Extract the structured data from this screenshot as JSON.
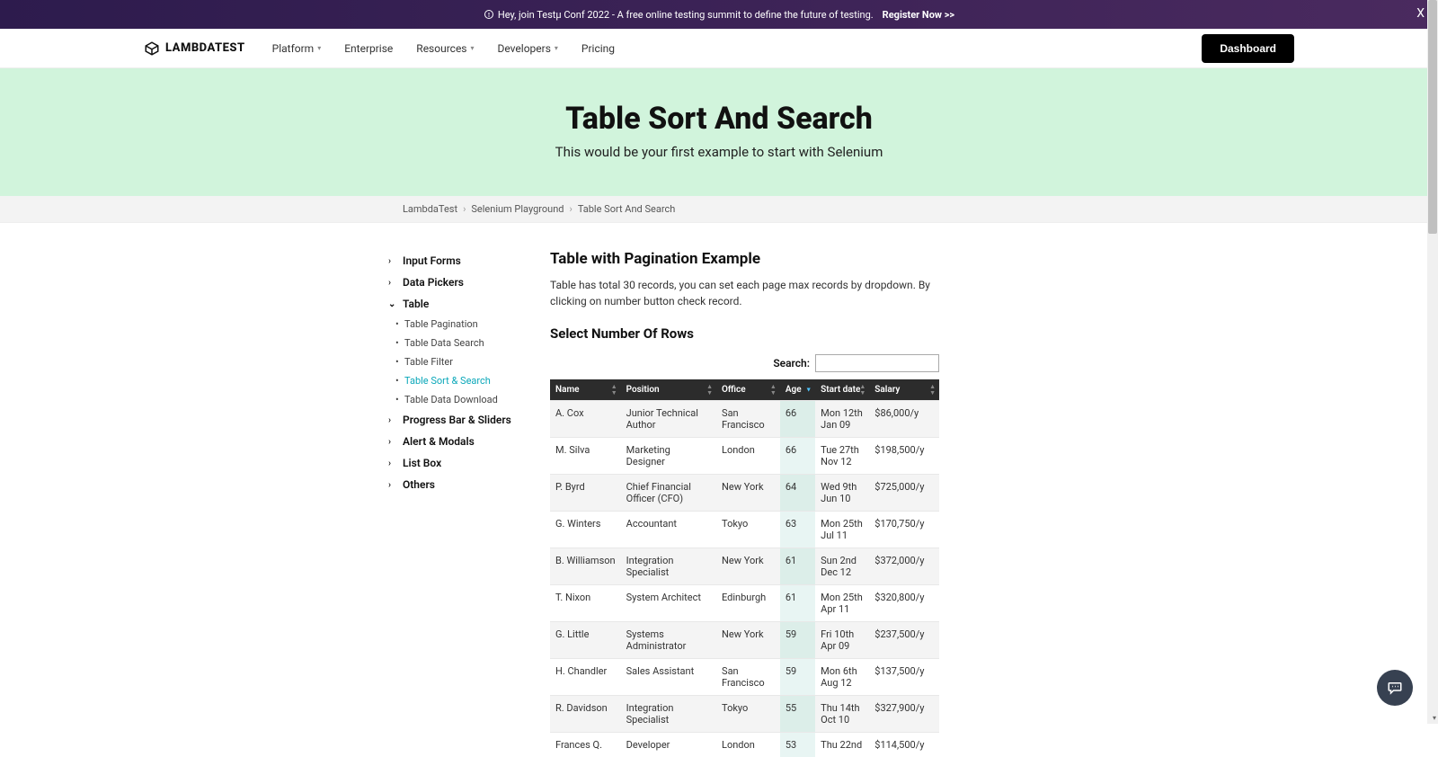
{
  "banner": {
    "text": "Hey, join Testμ Conf 2022 - A free online testing summit to define the future of testing.",
    "cta": "Register Now >>",
    "close": "X"
  },
  "nav": {
    "brand": "LAMBDATEST",
    "items": [
      "Platform",
      "Enterprise",
      "Resources",
      "Developers",
      "Pricing"
    ],
    "has_caret": [
      true,
      false,
      true,
      true,
      false
    ],
    "dashboard": "Dashboard"
  },
  "hero": {
    "title": "Table Sort And Search",
    "subtitle": "This would be your first example to start with Selenium"
  },
  "breadcrumbs": [
    "LambdaTest",
    "Selenium Playground",
    "Table Sort And Search"
  ],
  "sidebar": {
    "groups": [
      {
        "label": "Input Forms",
        "expanded": false
      },
      {
        "label": "Data Pickers",
        "expanded": false
      },
      {
        "label": "Table",
        "expanded": true,
        "children": [
          {
            "label": "Table Pagination",
            "active": false
          },
          {
            "label": "Table Data Search",
            "active": false
          },
          {
            "label": "Table Filter",
            "active": false
          },
          {
            "label": "Table Sort & Search",
            "active": true
          },
          {
            "label": "Table Data Download",
            "active": false
          }
        ]
      },
      {
        "label": "Progress Bar & Sliders",
        "expanded": false
      },
      {
        "label": "Alert & Modals",
        "expanded": false
      },
      {
        "label": "List Box",
        "expanded": false
      },
      {
        "label": "Others",
        "expanded": false
      }
    ]
  },
  "content": {
    "heading": "Table with Pagination Example",
    "desc": "Table has total 30 records, you can set each page max records by dropdown. By clicking on number button check record.",
    "rows_heading": "Select Number Of Rows",
    "search_label": "Search:",
    "columns": [
      "Name",
      "Position",
      "Office",
      "Age",
      "Start date",
      "Salary"
    ],
    "sorted_col": 3,
    "rows": [
      {
        "name": "A. Cox",
        "position": "Junior Technical Author",
        "office": "San Francisco",
        "age": "66",
        "start": "Mon 12th Jan 09",
        "salary": "$86,000/y"
      },
      {
        "name": "M. Silva",
        "position": "Marketing Designer",
        "office": "London",
        "age": "66",
        "start": "Tue 27th Nov 12",
        "salary": "$198,500/y"
      },
      {
        "name": "P. Byrd",
        "position": "Chief Financial Officer (CFO)",
        "office": "New York",
        "age": "64",
        "start": "Wed 9th Jun 10",
        "salary": "$725,000/y"
      },
      {
        "name": "G. Winters",
        "position": "Accountant",
        "office": "Tokyo",
        "age": "63",
        "start": "Mon 25th Jul 11",
        "salary": "$170,750/y"
      },
      {
        "name": "B. Williamson",
        "position": "Integration Specialist",
        "office": "New York",
        "age": "61",
        "start": "Sun 2nd Dec 12",
        "salary": "$372,000/y"
      },
      {
        "name": "T. Nixon",
        "position": "System Architect",
        "office": "Edinburgh",
        "age": "61",
        "start": "Mon 25th Apr 11",
        "salary": "$320,800/y"
      },
      {
        "name": "G. Little",
        "position": "Systems Administrator",
        "office": "New York",
        "age": "59",
        "start": "Fri 10th Apr 09",
        "salary": "$237,500/y"
      },
      {
        "name": "H. Chandler",
        "position": "Sales Assistant",
        "office": "San Francisco",
        "age": "59",
        "start": "Mon 6th Aug 12",
        "salary": "$137,500/y"
      },
      {
        "name": "R. Davidson",
        "position": "Integration Specialist",
        "office": "Tokyo",
        "age": "55",
        "start": "Thu 14th Oct 10",
        "salary": "$327,900/y"
      },
      {
        "name": "Frances Q.",
        "position": "Developer",
        "office": "London",
        "age": "53",
        "start": "Thu 22nd",
        "salary": "$114,500/y"
      }
    ]
  }
}
